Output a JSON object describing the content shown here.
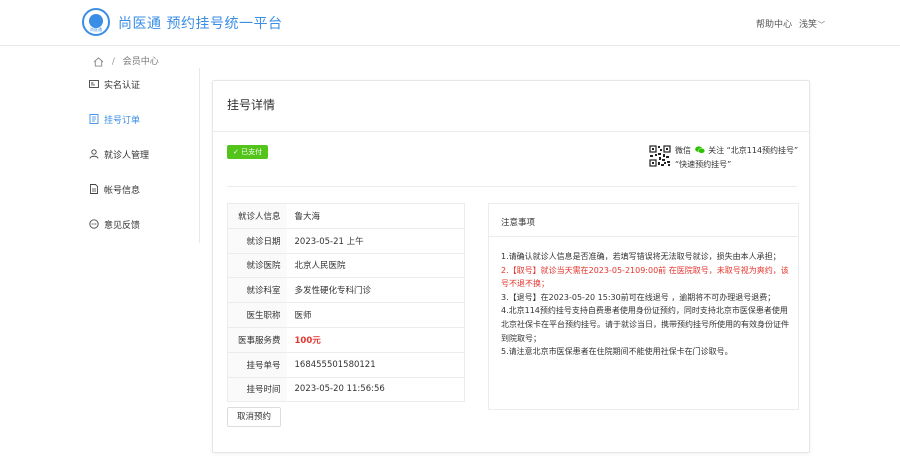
{
  "header": {
    "logo_text": "尚医通",
    "site_title": "尚医通 预约挂号统一平台",
    "help_label": "帮助中心",
    "user_name": "浅笑",
    "user_chevron": "﹀"
  },
  "breadcrumb": {
    "separator": "/",
    "current": "会员中心"
  },
  "sidebar": {
    "items": [
      {
        "label": "实名认证",
        "icon": "id-card-icon"
      },
      {
        "label": "挂号订单",
        "icon": "order-list-icon"
      },
      {
        "label": "就诊人管理",
        "icon": "user-icon"
      },
      {
        "label": "帐号信息",
        "icon": "document-icon"
      },
      {
        "label": "意见反馈",
        "icon": "chat-bubble-icon"
      }
    ],
    "active_index": 1
  },
  "detail": {
    "title": "挂号详情",
    "status_badge": "✓ 已支付",
    "wechat": {
      "line1_a": "微信",
      "line1_b": "关注 “北京114预约挂号”",
      "line2": "“快速预约挂号”"
    },
    "info_rows": [
      {
        "key": "就诊人信息",
        "value": "鲁大海"
      },
      {
        "key": "就诊日期",
        "value": "2023-05-21 上午"
      },
      {
        "key": "就诊医院",
        "value": "北京人民医院"
      },
      {
        "key": "就诊科室",
        "value": "多发性硬化专科门诊"
      },
      {
        "key": "医生职称",
        "value": "医师"
      },
      {
        "key": "医事服务费",
        "value": "100元"
      },
      {
        "key": "挂号单号",
        "value": "168455501580121"
      },
      {
        "key": "挂号时间",
        "value": "2023-05-20 11:56:56"
      }
    ],
    "cancel_button": "取消预约",
    "notice": {
      "title": "注意事项",
      "items": [
        "1.请确认就诊人信息是否准确，若填写错误将无法取号就诊，损失由本人承担；",
        "2.【取号】就诊当天需在2023-05-2109:00前 在医院取号，未取号视为爽约，该号不退不换；",
        "3.【退号】在2023-05-20 15:30前可在线退号 ，逾期将不可办理退号退费；",
        "4.北京114预约挂号支持自费患者使用身份证预约，同时支持北京市医保患者使用北京社保卡在平台预约挂号。请于就诊当日，携带预约挂号所使用的有效身份证件到院取号；",
        "5.请注意北京市医保患者在住院期间不能使用社保卡在门诊取号。"
      ]
    }
  },
  "colors": {
    "brand": "#3a8ee6",
    "paid": "#52c41a",
    "warning": "#e5342d"
  }
}
